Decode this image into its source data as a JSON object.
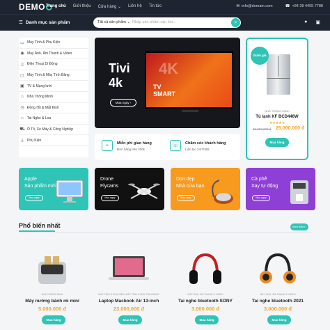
{
  "topbar": {
    "logo": "DEMO",
    "nav": [
      "Trang chủ",
      "Giới thiệu",
      "Cửa hàng ⌄",
      "Liên hệ",
      "Tin tức"
    ],
    "email": "info@domain.com",
    "phone": "+84 28 4455 7788"
  },
  "navbar": {
    "category_label": "Danh mục sản phẩm",
    "search_select": "Tất cả sản phẩm ⌄",
    "search_placeholder": "Nhập sản phẩm cần tìm..."
  },
  "sidebar": {
    "items": [
      {
        "label": "Máy Tính & Phụ Kiện",
        "icon": "laptop-icon"
      },
      {
        "label": "Máy Ảnh, Âm Thanh & Video",
        "icon": "camera-icon"
      },
      {
        "label": "Điện Thoại Di Động",
        "icon": "phone-icon"
      },
      {
        "label": "Máy Tính & Máy Tính Bảng",
        "icon": "tablet-icon"
      },
      {
        "label": "TV & Mạng lưới",
        "icon": "tv-icon"
      },
      {
        "label": "Nhà Thông Minh",
        "icon": "home-icon"
      },
      {
        "label": "Đồng Hồ & Mắt Kính",
        "icon": "watch-icon"
      },
      {
        "label": "Tai Nghe & Loa",
        "icon": "headphone-icon"
      },
      {
        "label": "Ô Tô, Xe Máy & Công Nghiệp",
        "icon": "car-icon"
      },
      {
        "label": "Phụ Kiện",
        "icon": "plug-icon"
      }
    ]
  },
  "hero": {
    "title_line1": "Tivi",
    "title_line2": "4k",
    "button": "Mua ngay ›",
    "screen_big": "4K",
    "screen_text1": "TV",
    "screen_text2": "SMART"
  },
  "features": [
    {
      "title": "Miễn phí giao hàng",
      "subtitle": "Đơn hàng trên 200k",
      "icon": "map-icon"
    },
    {
      "title": "Chăm sóc khách hàng",
      "subtitle": "Liên tục 24/7/365",
      "icon": "phone-support-icon"
    }
  ],
  "deal": {
    "badge": "Giảm giá",
    "brand": "NHÀ THÔNG MINH",
    "name": "Tủ lạnh KF BCD446W",
    "stars": "★★★★★",
    "old_price": "36.000.000 đ",
    "price": "25.000.000 đ",
    "button": "Mua hàng"
  },
  "promos": [
    {
      "title": "Apple",
      "subtitle": "Sản phẩm mới",
      "button": "Mua ngay",
      "color": "#2ec4b6"
    },
    {
      "title": "Drone",
      "subtitle": "Flycams",
      "button": "Mua ngay",
      "color": "#111111"
    },
    {
      "title": "Dọn dẹp",
      "subtitle": "Nhà cửa bạn",
      "button": "Mua ngay",
      "color": "#f79a1e"
    },
    {
      "title": "Cà phê",
      "subtitle": "Xay tự động",
      "button": "Mua ngay",
      "color": "#8e3fd6"
    }
  ],
  "popular": {
    "title": "Phổ biến nhất",
    "see_more": "Xem thêm ›",
    "products": [
      {
        "brand": "NHÀ THÔNG MINH",
        "name": "Máy nướng bánh mì mini",
        "price": "5.000.000 đ",
        "button": "Mua hàng"
      },
      {
        "brand": "MÁY TÍNH & PHỤ KIỆN, MÁY TÍNH & MÁY TÍNH BẢNG",
        "name": "Laptop Macbook Air 13-inch",
        "price": "23.000.000 đ",
        "button": "Mua hàng"
      },
      {
        "brand": "MÁY ẢNH, ÂM THANH & VIDEO",
        "name": "Tai nghe bluetooth SONY",
        "price": "3.000.000 đ",
        "button": "Mua hàng"
      },
      {
        "brand": "MÁY ẢNH, ÂM THANH & VIDEO",
        "name": "Tai nghe bluetooth 2021",
        "price": "3.000.000 đ",
        "button": "Mua hàng"
      }
    ]
  }
}
